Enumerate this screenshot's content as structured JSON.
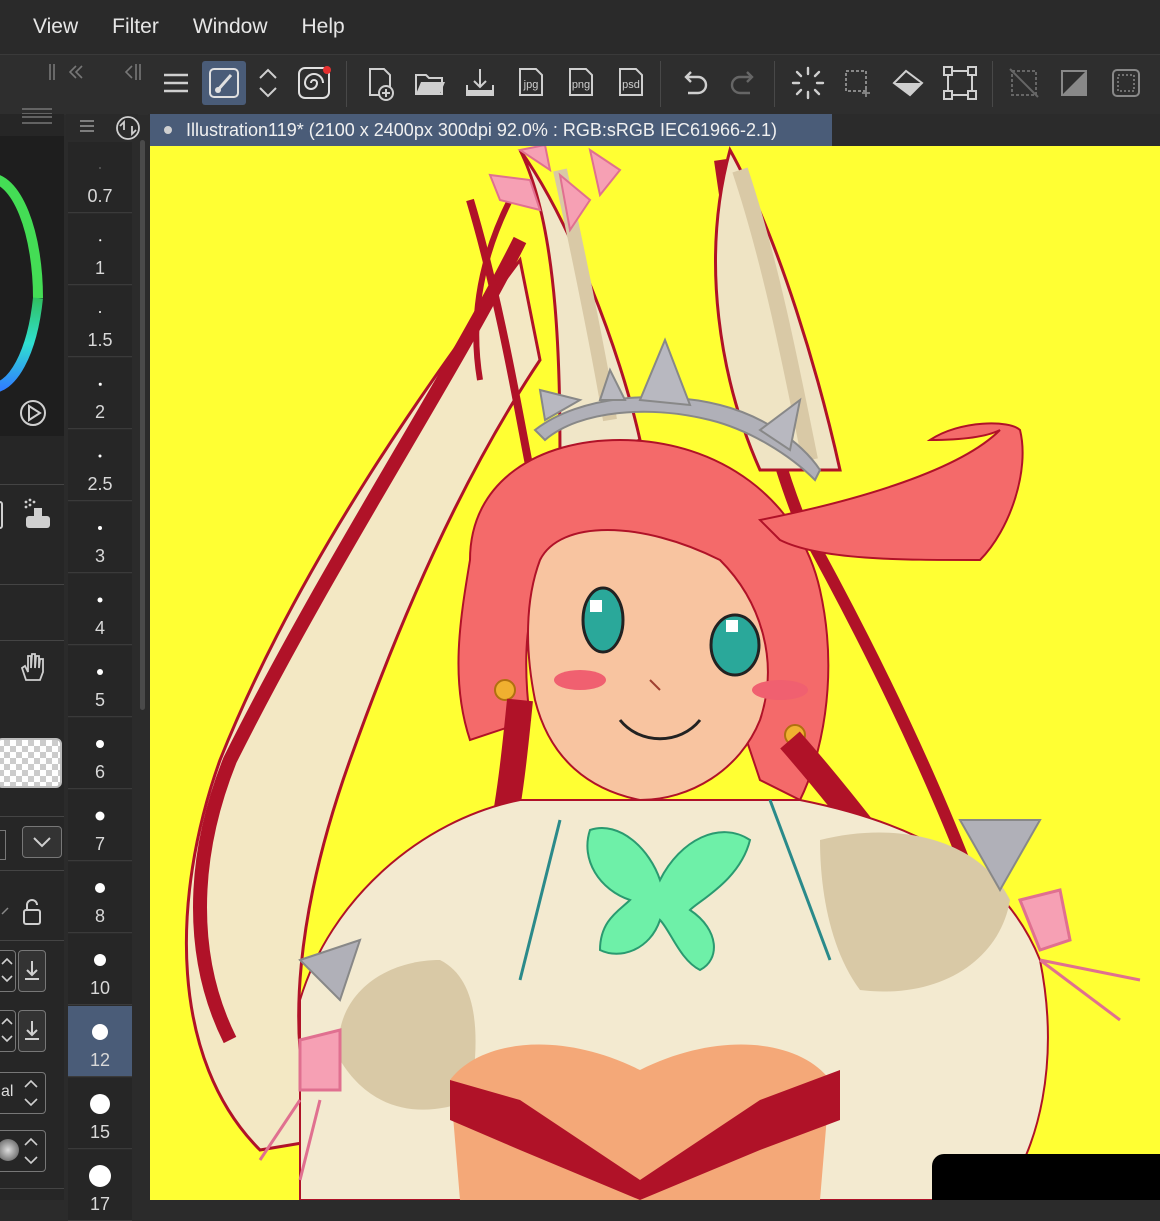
{
  "menu": [
    "View",
    "Filter",
    "Window",
    "Help"
  ],
  "toolbar": {
    "icons": [
      "menu-icon",
      "brush-active-icon",
      "up-down-icon",
      "spiral-icon",
      "new-file-icon",
      "open-folder-icon",
      "save-icon",
      "export-jpg-icon",
      "export-png-icon",
      "export-psd-icon",
      "undo-icon",
      "redo-icon",
      "loading-icon",
      "select-dots-icon",
      "fill-icon",
      "transform-icon",
      "clear-selection-icon",
      "tone-icon",
      "frame-icon"
    ],
    "jpg": "jpg",
    "png": "png",
    "psd": "psd"
  },
  "document_tab": {
    "title": "Illustration119* (2100 x 2400px 300dpi 92.0% : RGB:sRGB IEC61966-2.1)"
  },
  "brush_sizes": [
    "0.7",
    "1",
    "1.5",
    "2",
    "2.5",
    "3",
    "4",
    "5",
    "6",
    "7",
    "8",
    "10",
    "12",
    "15",
    "17"
  ],
  "selected_size": "12",
  "left_panel": {
    "blend_text": "al"
  },
  "colors": {
    "accent": "#4a5c78",
    "canvas_bg": "#ffff33"
  }
}
